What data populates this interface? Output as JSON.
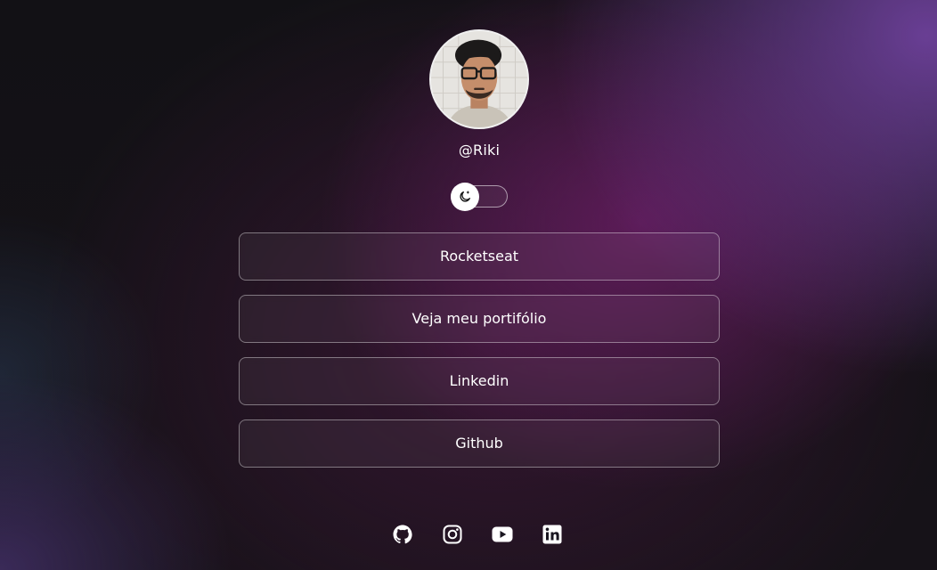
{
  "profile": {
    "username": "@Riki",
    "avatar_alt": "Foto de perfil"
  },
  "theme_switch": {
    "icon": "moon-icon",
    "state": "dark"
  },
  "links": [
    {
      "label": "Rocketseat"
    },
    {
      "label": "Veja meu portifólio"
    },
    {
      "label": "Linkedin"
    },
    {
      "label": "Github"
    }
  ],
  "social": [
    {
      "icon": "github-icon"
    },
    {
      "icon": "instagram-icon"
    },
    {
      "icon": "youtube-icon"
    },
    {
      "icon": "linkedin-icon"
    }
  ],
  "colors": {
    "text": "#ffffff",
    "accent_purple": "#6e1e69",
    "background": "#141216"
  }
}
